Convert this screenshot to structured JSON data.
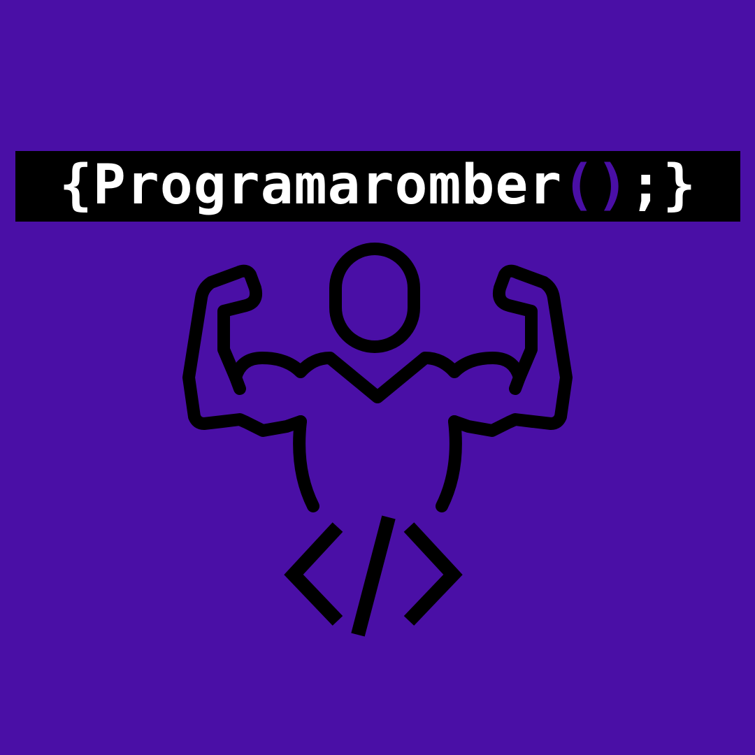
{
  "colors": {
    "background": "#4a0fa6",
    "bar": "#000000",
    "text": "#ffffff",
    "accent_parens": "#4a0fa6"
  },
  "title": {
    "open_brace": "{",
    "name": "Programaromber",
    "open_paren": "(",
    "close_paren": ")",
    "semicolon": ";",
    "close_brace": "}"
  },
  "icons": [
    "flexing-muscle-man-icon",
    "code-brackets-icon"
  ]
}
